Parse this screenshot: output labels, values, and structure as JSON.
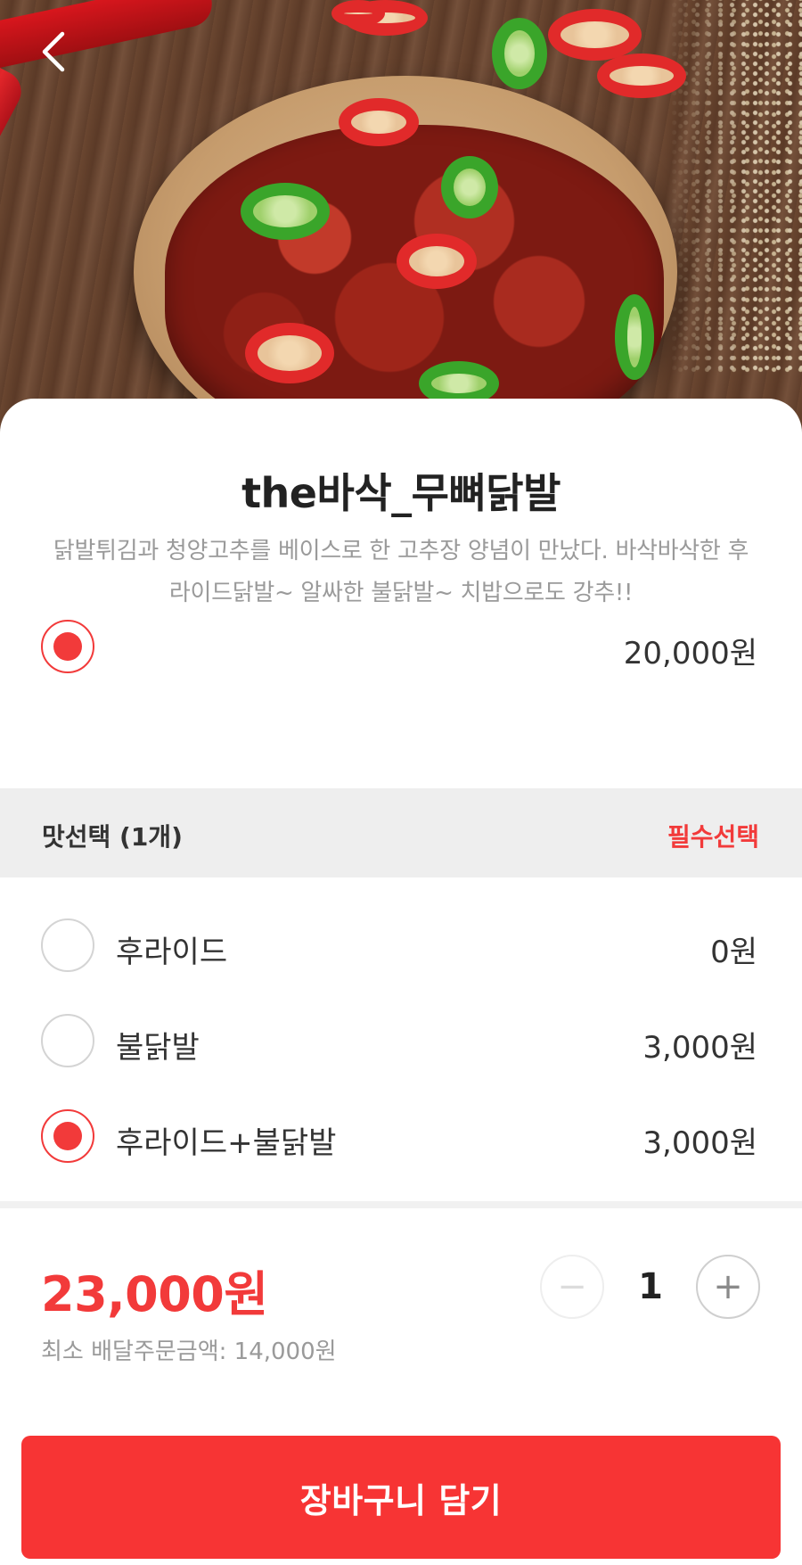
{
  "product": {
    "title": "the바삭_무뼈닭발",
    "description": "닭발튀김과 청양고추를 베이스로 한 고추장 양념이 만났다. 바삭바삭한 후라이드닭발~ 알싸한 불닭발~ 치밥으로도 강추!!"
  },
  "base_option": {
    "price": "20,000원",
    "selected": true
  },
  "flavor_section": {
    "title": "맛선택 (1개)",
    "required": "필수선택",
    "options": [
      {
        "label": "후라이드",
        "price": "0원",
        "selected": false
      },
      {
        "label": "불닭발",
        "price": "3,000원",
        "selected": false
      },
      {
        "label": "후라이드+불닭발",
        "price": "3,000원",
        "selected": true
      }
    ]
  },
  "order": {
    "total": "23,000원",
    "min_order": "최소 배달주문금액: 14,000원",
    "quantity": "1",
    "minus": "−",
    "plus": "+"
  },
  "cart_button": {
    "label": "장바구니 담기"
  },
  "icons": {
    "back": "chevron-left-icon"
  },
  "colors": {
    "accent": "#f23a3a",
    "button": "#f73434",
    "muted": "#9a9a9a"
  }
}
